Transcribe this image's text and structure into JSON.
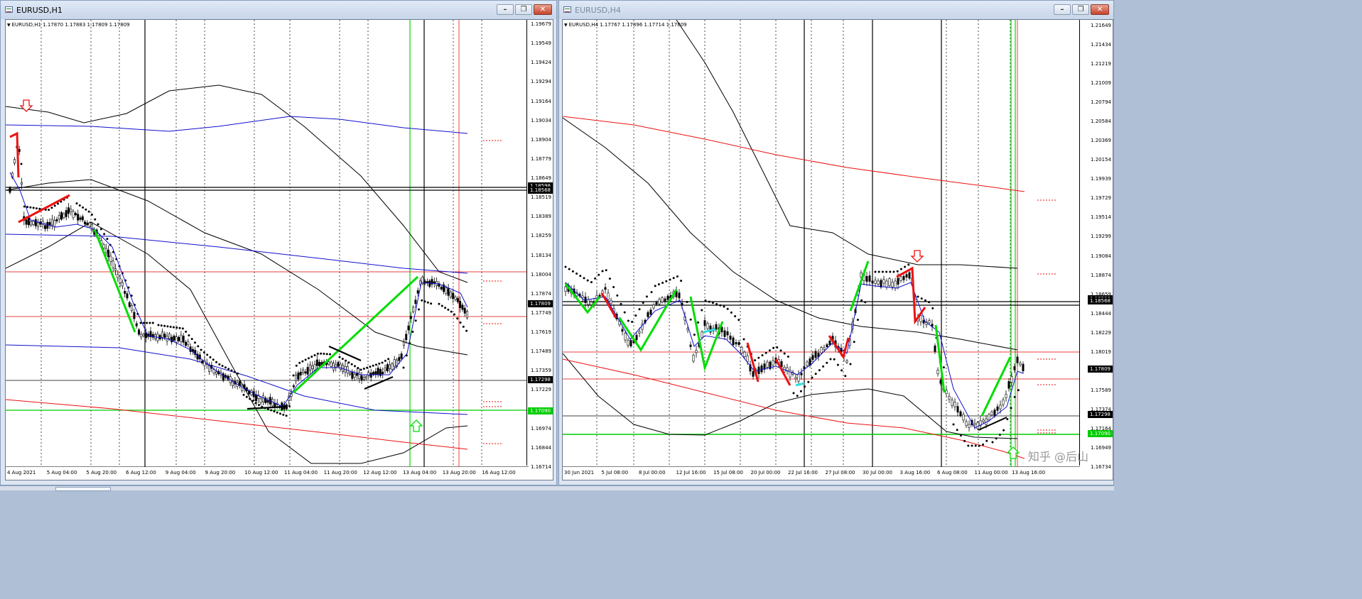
{
  "colors": {
    "bull_line": "#00dd00",
    "bear_line": "#ee1111",
    "bb": "#000000",
    "ma_blue": "#1010cc",
    "ma_red": "#ee1111",
    "grid": "#000000",
    "cyan": "#33dddd",
    "box_black": "#000000",
    "box_red": "#dd0000",
    "box_green": "#00cc00"
  },
  "icons": {
    "app": "chart-window-icon",
    "minimize": "minimize-icon",
    "restore": "restore-icon",
    "close": "close-icon",
    "arrow_down": "red-down-arrow-icon",
    "arrow_up": "green-up-arrow-icon",
    "dropdown": "triangle-down-icon"
  },
  "left_window": {
    "title": "EURUSD,H1",
    "header": "EURUSD,H1  1.17870 1.17883 1.17809 1.17809",
    "price_range": [
      1.16714,
      1.19679
    ],
    "price_ticks": [
      "1.19679",
      "1.19549",
      "1.19424",
      "1.19294",
      "1.19164",
      "1.19034",
      "1.18904",
      "1.18779",
      "1.18649",
      "1.18519",
      "1.18389",
      "1.18259",
      "1.18134",
      "1.18004",
      "1.17874",
      "1.17749",
      "1.17619",
      "1.17489",
      "1.17359",
      "1.17229",
      "1.17104",
      "1.16974",
      "1.16844",
      "1.16714"
    ],
    "price_labels": [
      {
        "text": "1.18598",
        "color": "#000000",
        "price": 1.18598
      },
      {
        "text": "1.18568",
        "color": "#000000",
        "price": 1.18568
      },
      {
        "text": "1.17809",
        "color": "#000000",
        "price": 1.17809
      },
      {
        "text": "1.17298",
        "color": "#000000",
        "price": 1.17298
      },
      {
        "text": "1.17090",
        "color": "#00cc00",
        "price": 1.1709
      }
    ],
    "time_labels": [
      "4 Aug 2021",
      "5 Aug 04:00",
      "5 Aug 20:00",
      "6 Aug 12:00",
      "9 Aug 04:00",
      "9 Aug 20:00",
      "10 Aug 12:00",
      "11 Aug 04:00",
      "11 Aug 20:00",
      "12 Aug 12:00",
      "13 Aug 04:00",
      "13 Aug 20:00",
      "16 Aug 12:00"
    ]
  },
  "right_window": {
    "title": "EURUSD,H4",
    "header": "EURUSD,H4  1.17767 1.17896 1.17714 1.17809",
    "price_range": [
      1.16714,
      1.21649
    ],
    "price_ticks": [
      "1.21649",
      "1.21434",
      "1.21219",
      "1.21009",
      "1.20794",
      "1.20584",
      "1.20369",
      "1.20154",
      "1.19939",
      "1.19729",
      "1.19514",
      "1.19299",
      "1.19084",
      "1.18874",
      "1.18659",
      "1.18444",
      "1.18229",
      "1.18019",
      "1.17804",
      "1.17589",
      "1.17374",
      "1.17164",
      "1.16949",
      "1.16734"
    ],
    "price_labels": [
      {
        "text": "1.18598",
        "color": "#000000",
        "price": 1.18598
      },
      {
        "text": "1.18568",
        "color": "#000000",
        "price": 1.18568
      },
      {
        "text": "1.17809",
        "color": "#000000",
        "price": 1.17809
      },
      {
        "text": "1.17298",
        "color": "#000000",
        "price": 1.17298
      },
      {
        "text": "1.17090",
        "color": "#00cc00",
        "price": 1.1709
      }
    ],
    "time_labels": [
      "30 Jun 2021",
      "5 Jul 08:00",
      "8 Jul 00:00",
      "12 Jul 16:00",
      "15 Jul 08:00",
      "20 Jul 00:00",
      "22 Jul 16:00",
      "27 Jul 08:00",
      "30 Jul 00:00",
      "3 Aug 16:00",
      "6 Aug 08:00",
      "11 Aug 00:00",
      "13 Aug 16:00"
    ],
    "watermark": "知乎 @后山"
  }
}
